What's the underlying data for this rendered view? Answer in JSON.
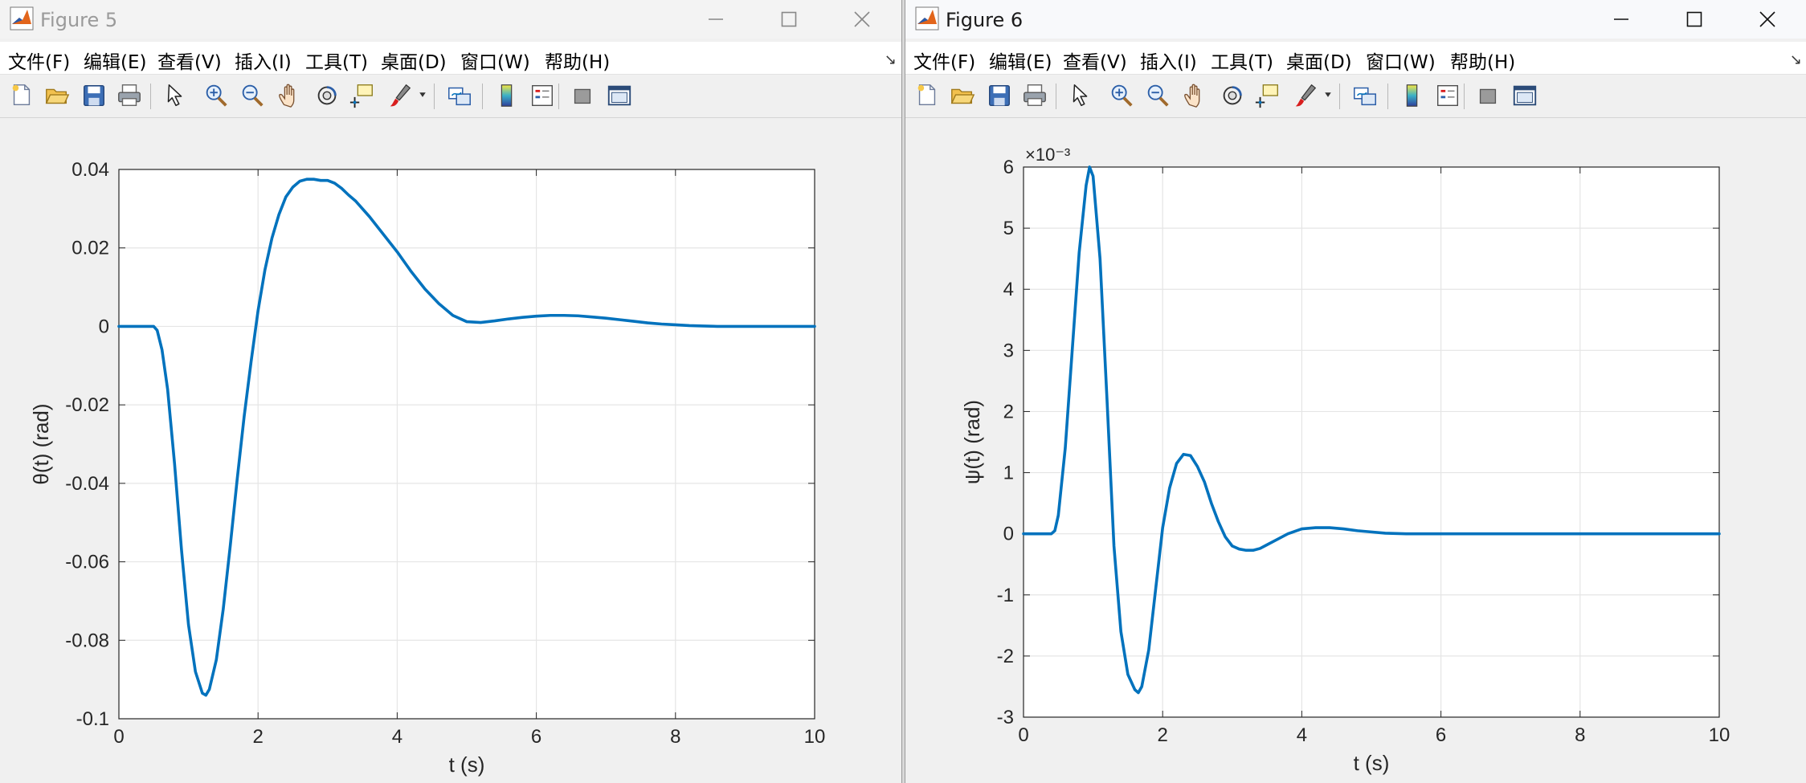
{
  "colors": {
    "line": "#0072BD",
    "grid": "#e5e5e5",
    "axes": "#262626",
    "window_bg": "#f0f0f0"
  },
  "menu_labels": [
    "文件(F)",
    "编辑(E)",
    "查看(V)",
    "插入(I)",
    "工具(T)",
    "桌面(D)",
    "窗口(W)",
    "帮助(H)"
  ],
  "toolbar_icons": [
    "new-figure-icon",
    "open-file-icon",
    "save-icon",
    "print-icon",
    "pointer-icon",
    "zoom-in-icon",
    "zoom-out-icon",
    "pan-hand-icon",
    "rotate-3d-icon",
    "data-cursor-icon",
    "brush-icon",
    "brush-dropdown-icon",
    "link-plot-icon",
    "colorbar-icon",
    "legend-icon",
    "hide-plot-tools-icon",
    "show-plot-tools-icon"
  ],
  "windows": [
    {
      "title": "Figure 5",
      "active": false
    },
    {
      "title": "Figure 6",
      "active": true
    }
  ],
  "chart_data": [
    {
      "type": "line",
      "title": "",
      "xlabel": "t (s)",
      "ylabel": "θ(t) (rad)",
      "xlim": [
        0,
        10
      ],
      "ylim": [
        -0.1,
        0.04
      ],
      "xticks": [
        0,
        2,
        4,
        6,
        8,
        10
      ],
      "xtick_labels": [
        "0",
        "2",
        "4",
        "6",
        "8",
        "10"
      ],
      "yticks": [
        -0.1,
        -0.08,
        -0.06,
        -0.04,
        -0.02,
        0,
        0.02,
        0.04
      ],
      "ytick_labels": [
        "-0.1",
        "-0.08",
        "-0.06",
        "-0.04",
        "-0.02",
        "0",
        "0.02",
        "0.04"
      ],
      "exponent_label": "",
      "grid": true,
      "series": [
        {
          "x": [
            0,
            0.5,
            0.55,
            0.62,
            0.7,
            0.8,
            0.9,
            1.0,
            1.1,
            1.2,
            1.25,
            1.3,
            1.4,
            1.5,
            1.6,
            1.7,
            1.8,
            1.9,
            2.0,
            2.1,
            2.2,
            2.3,
            2.4,
            2.5,
            2.6,
            2.7,
            2.8,
            2.9,
            3.0,
            3.1,
            3.2,
            3.3,
            3.4,
            3.6,
            3.8,
            4.0,
            4.2,
            4.4,
            4.6,
            4.8,
            5.0,
            5.2,
            5.4,
            5.6,
            5.8,
            6.0,
            6.2,
            6.4,
            6.6,
            6.8,
            7.0,
            7.2,
            7.4,
            7.6,
            7.8,
            8.0,
            8.2,
            8.4,
            8.6,
            8.8,
            9.0,
            9.5,
            10.0
          ],
          "y": [
            0,
            0,
            -0.001,
            -0.006,
            -0.016,
            -0.035,
            -0.057,
            -0.076,
            -0.088,
            -0.0935,
            -0.094,
            -0.0925,
            -0.085,
            -0.072,
            -0.056,
            -0.039,
            -0.023,
            -0.009,
            0.004,
            0.0145,
            0.0225,
            0.0285,
            0.033,
            0.0355,
            0.037,
            0.0375,
            0.0375,
            0.0372,
            0.0372,
            0.0365,
            0.0352,
            0.0335,
            0.032,
            0.028,
            0.0235,
            0.019,
            0.014,
            0.0095,
            0.0058,
            0.0028,
            0.0012,
            0.001,
            0.0014,
            0.0019,
            0.0023,
            0.0026,
            0.0028,
            0.0028,
            0.0027,
            0.0024,
            0.0021,
            0.0017,
            0.0013,
            0.0009,
            0.0006,
            0.0004,
            0.0002,
            0.0001,
            0.0,
            0.0,
            0.0,
            0.0,
            0.0
          ]
        }
      ]
    },
    {
      "type": "line",
      "title": "",
      "xlabel": "t (s)",
      "ylabel": "ψ(t) (rad)",
      "xlim": [
        0,
        10
      ],
      "ylim": [
        -3,
        6
      ],
      "xticks": [
        0,
        2,
        4,
        6,
        8,
        10
      ],
      "xtick_labels": [
        "0",
        "2",
        "4",
        "6",
        "8",
        "10"
      ],
      "yticks": [
        -3,
        -2,
        -1,
        0,
        1,
        2,
        3,
        4,
        5,
        6
      ],
      "ytick_labels": [
        "-3",
        "-2",
        "-1",
        "0",
        "1",
        "2",
        "3",
        "4",
        "5",
        "6"
      ],
      "exponent_label": "×10⁻³",
      "grid": true,
      "series": [
        {
          "x": [
            0,
            0.4,
            0.45,
            0.5,
            0.6,
            0.7,
            0.8,
            0.9,
            0.95,
            1.0,
            1.1,
            1.2,
            1.3,
            1.4,
            1.5,
            1.6,
            1.65,
            1.7,
            1.8,
            1.9,
            2.0,
            2.1,
            2.2,
            2.3,
            2.4,
            2.5,
            2.6,
            2.7,
            2.8,
            2.9,
            3.0,
            3.1,
            3.2,
            3.3,
            3.4,
            3.5,
            3.6,
            3.8,
            4.0,
            4.2,
            4.4,
            4.6,
            4.8,
            5.0,
            5.2,
            5.5,
            6.0,
            6.5,
            7.0,
            8.0,
            9.0,
            10.0
          ],
          "y": [
            0,
            0,
            0.05,
            0.3,
            1.4,
            3.0,
            4.6,
            5.7,
            6.0,
            5.85,
            4.5,
            2.2,
            -0.2,
            -1.6,
            -2.3,
            -2.55,
            -2.6,
            -2.5,
            -1.9,
            -0.9,
            0.1,
            0.75,
            1.15,
            1.3,
            1.28,
            1.1,
            0.85,
            0.5,
            0.2,
            -0.05,
            -0.2,
            -0.25,
            -0.27,
            -0.27,
            -0.24,
            -0.18,
            -0.12,
            0.0,
            0.08,
            0.1,
            0.1,
            0.08,
            0.05,
            0.03,
            0.01,
            0.0,
            0.0,
            0.0,
            0.0,
            0.0,
            0.0,
            0.0
          ]
        }
      ]
    }
  ]
}
